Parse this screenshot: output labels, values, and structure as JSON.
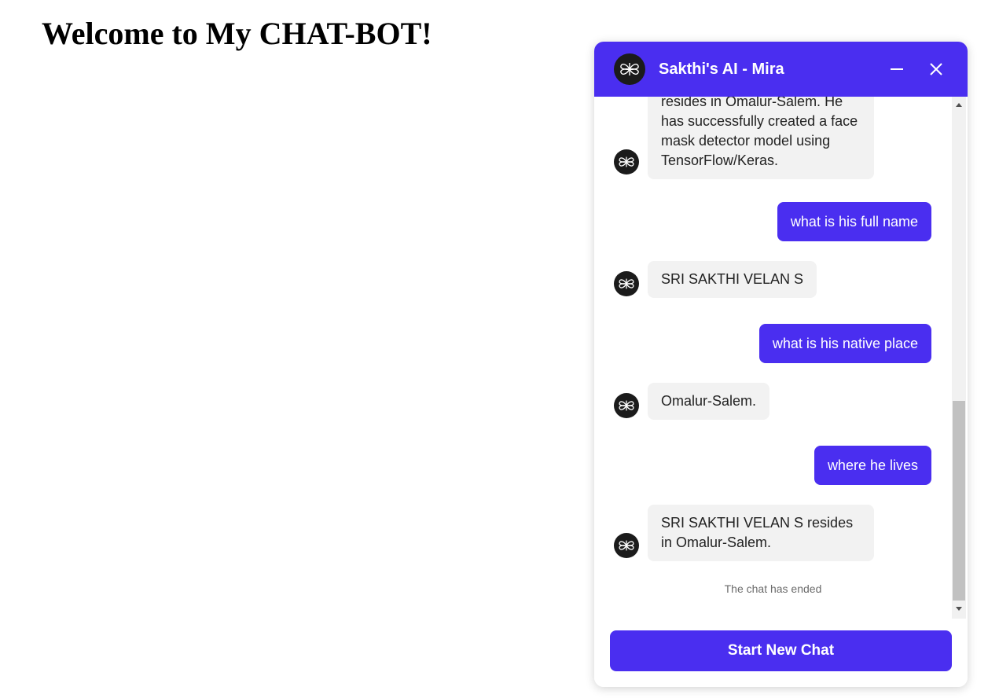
{
  "page": {
    "title": "Welcome to My CHAT-BOT!"
  },
  "chat": {
    "title": "Sakthi's AI - Mira",
    "messages": [
      {
        "sender": "bot",
        "text": "resides in Omalur-Salem. He has successfully created a face mask detector model using TensorFlow/Keras."
      },
      {
        "sender": "user",
        "text": "what is his full name"
      },
      {
        "sender": "bot",
        "text": "SRI SAKTHI VELAN S"
      },
      {
        "sender": "user",
        "text": "what is his native place"
      },
      {
        "sender": "bot",
        "text": "Omalur-Salem."
      },
      {
        "sender": "user",
        "text": "where he lives"
      },
      {
        "sender": "bot",
        "text": "SRI SAKTHI VELAN S resides in Omalur-Salem."
      }
    ],
    "ended_text": "The chat has ended",
    "start_button_label": "Start New Chat"
  },
  "icons": {
    "avatar": "bot-logo-icon",
    "minimize": "minimize-icon",
    "close": "close-icon"
  },
  "colors": {
    "accent": "#4a2ef0",
    "bot_bubble": "#f2f2f2",
    "avatar_bg": "#1b1b1b"
  }
}
